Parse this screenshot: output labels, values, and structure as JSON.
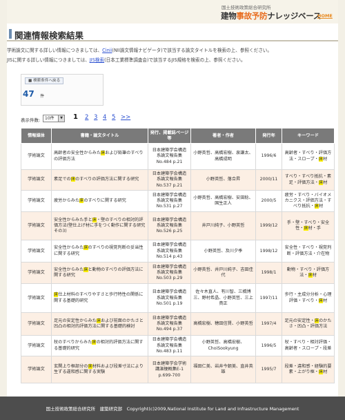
{
  "header": {
    "institute": "国土技術政策総合研究所",
    "logo_pre": "建物",
    "logo_accent": "事故予防",
    "logo_post": "ナレッジベース",
    "home": "HOME"
  },
  "page_title": "関連情報検索結果",
  "intro": [
    {
      "pre": "学術論文に関する詳しい情報につきましては、",
      "link": "Cinii",
      "post": "(NII論文情報ナビゲータ)で該当する論文タイトルを検索の上、参照ください。"
    },
    {
      "pre": "JISに関する詳しい情報につきましては、",
      "link": "JIS検索",
      "post": "(日本工業標準調査会)で該当するJIS規格を検索の上、参照ください。"
    }
  ],
  "search_conditions_back": "検索条件へ戻る",
  "result_count": "47",
  "result_unit": "件",
  "per_page_label": "表示件数:",
  "per_page_value": "10件",
  "pagination": {
    "current": "1",
    "pages": [
      "2",
      "3",
      "4",
      "5"
    ],
    "next": ">>"
  },
  "table": {
    "headers": [
      "情報媒体",
      "書籍・論文タイトル",
      "発行、掲載誌ページ等",
      "著者・作者",
      "発行年",
      "キーワード"
    ],
    "rows": [
      {
        "media": "学術論文",
        "title": [
          "高齢者の安全性からみた",
          "床",
          "および鉛筆のすべりの評価方法"
        ],
        "pub": "日本建築学会構造系論文報告集 No.484 p.21",
        "author": "小野英哲、高橋宏樹、泉謙太、高橋成明",
        "year": "1996/6",
        "kw": [
          "高齢者・すべり・評価方法・スロープ・",
          "床",
          "材"
        ]
      },
      {
        "media": "学術論文",
        "title": [
          "素足での",
          "床",
          "のすべりの評価方法に関する研究"
        ],
        "pub": "日本建築学会構造系論文報告集 No.537 p.21",
        "author": "小野英哲、落合昇",
        "year": "2000/11",
        "kw": [
          "すべり・すべり抵抗・素足・評価方法・",
          "床",
          "材"
        ]
      },
      {
        "media": "学術論文",
        "title": [
          "疲労からみた",
          "床",
          "のすべりに関する研究"
        ],
        "pub": "日本建築学会構造系論文報告集 No.531 p.27",
        "author": "小野英哲、高橋宏樹、安田稔、国生正人",
        "year": "2000/5",
        "kw": [
          "疲労・すべり・バイオメカニクス・評価方法・すべり抵抗・",
          "床",
          "材"
        ]
      },
      {
        "media": "学術論文",
        "title": [
          "安全性からみた手と",
          "床",
          "・壁のすべりの相対的評価方法(壁仕上げ材に手をつく動作に関する研究その3)"
        ],
        "pub": "日本建築学会構造系論文報告集 No.526 p.25",
        "author": "井戸川純子、小野英哲",
        "year": "1999/12",
        "kw": [
          "手・壁・すべり・安全性・",
          "床",
          "材・手"
        ]
      },
      {
        "media": "学術論文",
        "title": [
          "安全性からみた",
          "床",
          "のすべりの視覚判断の妥当性に関する研究"
        ],
        "pub": "日本建築学会構造系論文報告集 No.514 p.43",
        "author": "小野英哲、及川夕季",
        "year": "1998/12",
        "kw": [
          "安全性・すべり・視覚判断・評価方法・介在物"
        ]
      },
      {
        "media": "学術論文",
        "title": [
          "安全性からみた",
          "床",
          "と動物のすべりの評価方法に関する研究"
        ],
        "pub": "日本建築学会構造系論文報告集 No.503 p.29",
        "author": "小野英哲、井戸川純子、吉田佳代",
        "year": "1998/1",
        "kw": [
          "動物・すべり・評価方法・",
          "床",
          "材"
        ]
      },
      {
        "media": "学術論文",
        "title": [
          "",
          "床",
          "仕上材料のすべりやすさと歩行特性の関係に関する基礎的研究"
        ],
        "pub": "日本建築学会構造系論文報告集 No.501 p.19",
        "author": "佐々木直人、有川智、三橋博三、野村希晶、小野英哲、三上貴正",
        "year": "1997/11",
        "kw": [
          "歩行・主成分分析・心理評価・すべり・",
          "床",
          "材"
        ]
      },
      {
        "media": "学術論文",
        "title": [
          "足元の安定性からみた",
          "床",
          "および前面のかたさと凹凸の相対的評価方法に関する基礎的検討"
        ],
        "pub": "日本建築学会構造系論文報告集 No.494 p.37",
        "author": "高橋宏樹、穂田信賢、小野英哲",
        "year": "1997/4",
        "kw": [
          "足元の安定性・",
          "床",
          "のかたさ・凹凸・評価方法"
        ]
      },
      {
        "media": "学術論文",
        "title": [
          "杖のすべりからみた",
          "床",
          "の相対的評価方法に関する基礎的研究"
        ],
        "pub": "日本建築学会構造系論文報告集 No.483 p.11",
        "author": "小野英哲、高橋宏樹、ChoiSookyung",
        "year": "1996/5",
        "kw": [
          "杖・すべり・相対評価・高齢者・スロープ・段差"
        ]
      },
      {
        "media": "学術論文",
        "title": [
          "玄関上り框部分の",
          "床",
          "材料および段差寸法により生ずる違和感に関する実験"
        ],
        "pub": "日本建築学会学術講演梗概集E-1 p.699-700",
        "author": "福田仁美、岩井今朝美、直井英雄",
        "year": "1995/7",
        "kw": [
          "段差・違和感・経験的要素・上がり框・",
          "床",
          "材"
        ]
      }
    ]
  },
  "footer": "国土技術政策総合研究所　建築研究部　Copyright(c)2009,National Institute for Land and Infrastructure Management"
}
